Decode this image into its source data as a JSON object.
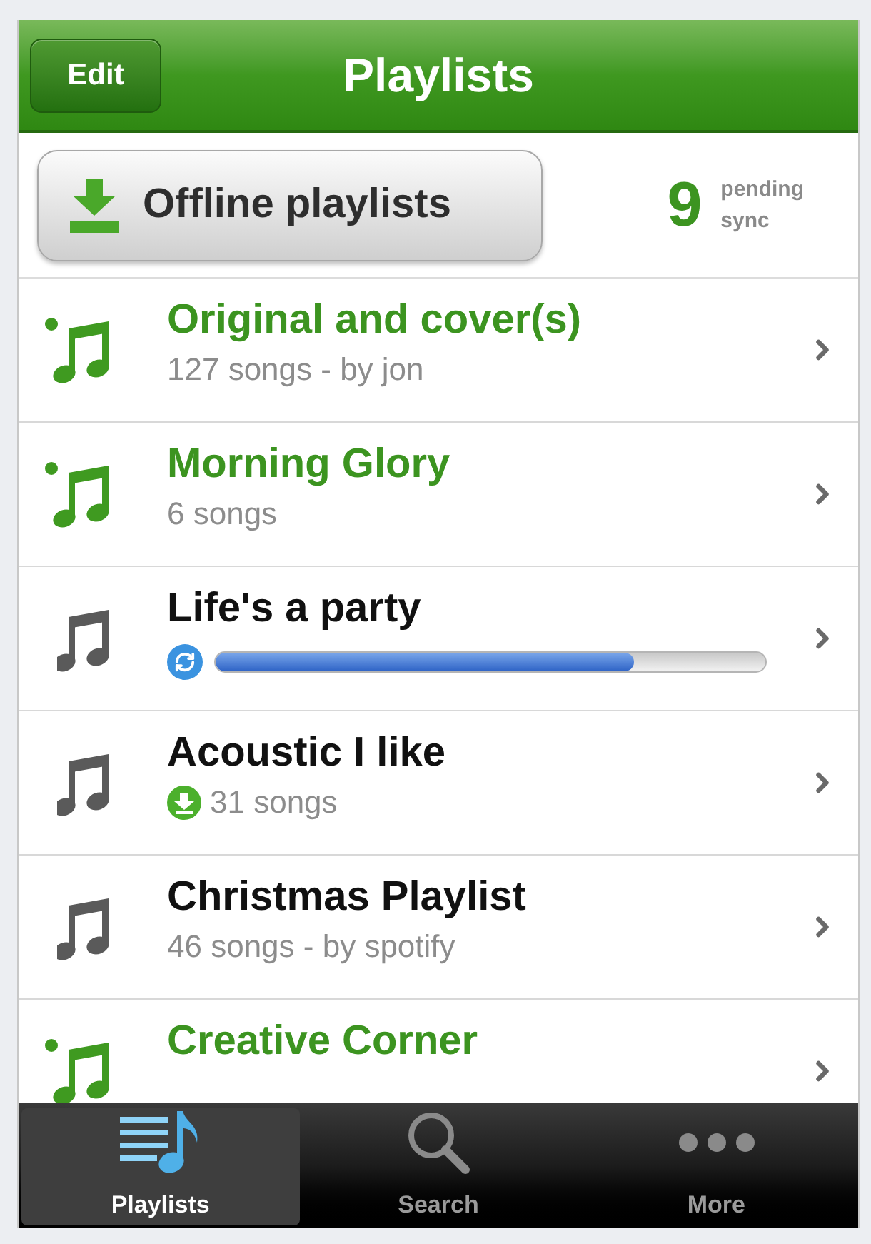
{
  "header": {
    "edit_button": "Edit",
    "title": "Playlists"
  },
  "offline": {
    "button": "Offline playlists",
    "pending_count": "9",
    "pending_label": "pending sync"
  },
  "playlists": [
    {
      "title": "Original and cover(s)",
      "subtitle": "127 songs - by jon",
      "offline": true,
      "kind": "info"
    },
    {
      "title": "Morning Glory",
      "subtitle": "6 songs",
      "offline": true,
      "kind": "info"
    },
    {
      "title": "Life's a party",
      "offline": false,
      "kind": "progress",
      "level": 0.76
    },
    {
      "title": "Acoustic I like",
      "subtitle": "31 songs",
      "offline": false,
      "kind": "downloaded"
    },
    {
      "title": "Christmas Playlist",
      "subtitle": "46 songs - by spotify",
      "offline": false,
      "kind": "info"
    },
    {
      "title": "Creative Corner",
      "offline": true,
      "kind": "info"
    }
  ],
  "tabs": [
    {
      "label": "Playlists",
      "selected": true
    },
    {
      "label": "Search",
      "selected": false
    },
    {
      "label": "More",
      "selected": false
    }
  ]
}
